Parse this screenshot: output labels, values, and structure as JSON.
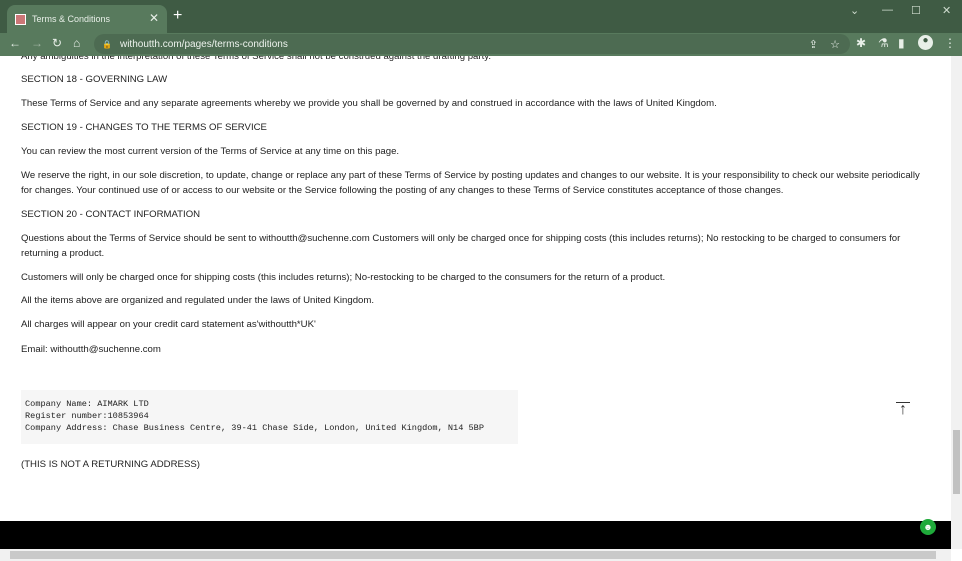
{
  "browser": {
    "tab_title": "Terms & Conditions",
    "url": "withoutth.com/pages/terms-conditions"
  },
  "content": {
    "clipped_line": "Any ambiguities in the interpretation of these Terms of Service shall not be construed against the drafting party.",
    "paragraphs": [
      "SECTION 18 - GOVERNING LAW",
      "These Terms of Service and any separate agreements whereby we provide you shall be governed by and construed in accordance with the laws of United Kingdom.",
      "SECTION 19 - CHANGES TO THE TERMS OF SERVICE",
      "You can review the most current version of the Terms of Service at any time on this page.",
      "We reserve the right, in our sole discretion, to update, change or replace any part of these Terms of Service by posting updates and changes to our website. It is your responsibility to check our website periodically for changes. Your continued use of or access to our website or the Service following the posting of any changes to these Terms of Service constitutes acceptance of those changes.",
      "SECTION 20 - CONTACT INFORMATION",
      "Questions about the Terms of Service should be sent to withoutth@suchenne.com Customers will only be charged once for shipping costs (this includes returns); No restocking to be charged to consumers for returning a product.",
      "Customers will only be charged once for shipping costs (this includes returns); No-restocking to be charged to the consumers for the return of a product.",
      "All the items above are organized and regulated under the laws of United Kingdom.",
      "All charges will appear on your credit card statement as'withoutth*UK'",
      "Email: withoutth@suchenne.com"
    ],
    "company_block": "Company Name: AIMARK LTD\nRegister number:10853964\nCompany Address: Chase Business Centre, 39-41 Chase Side, London, United Kingdom, N14 5BP",
    "note": "(THIS IS NOT A RETURNING ADDRESS)"
  },
  "colors": {
    "browser_frame": "#3f5b44",
    "toolbar": "#587a5d",
    "chat_button": "#1faa3a"
  }
}
